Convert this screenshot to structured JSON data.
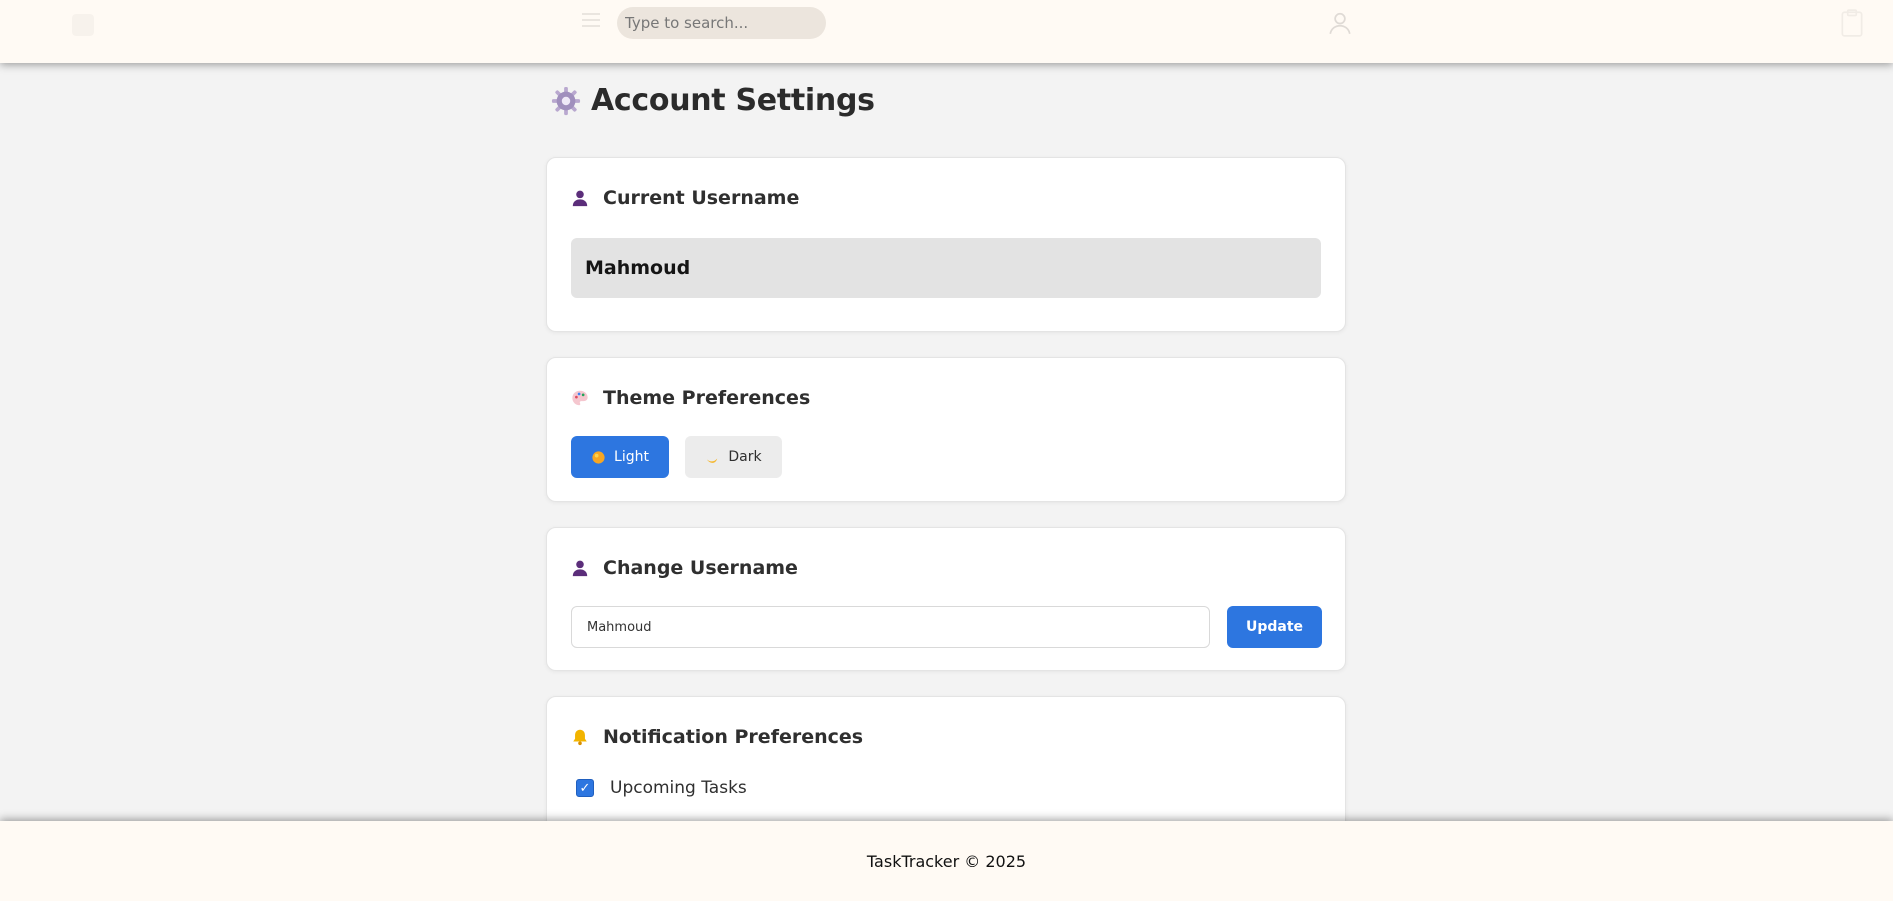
{
  "header": {
    "search_placeholder": "Type to search...",
    "menu_icon": "hamburger-icon",
    "user_icon": "user-icon",
    "clipboard_icon": "clipboard-icon"
  },
  "page": {
    "title": "Account Settings",
    "title_icon": "gear-icon"
  },
  "current_username": {
    "heading": "Current Username",
    "icon": "person-icon",
    "value": "Mahmoud"
  },
  "theme": {
    "heading": "Theme Preferences",
    "icon": "palette-icon",
    "light_label": "Light",
    "light_icon": "sun-icon",
    "dark_label": "Dark",
    "dark_icon": "moon-icon",
    "selected": "Light"
  },
  "change_username": {
    "heading": "Change Username",
    "icon": "person-icon",
    "input_value": "Mahmoud",
    "button_label": "Update"
  },
  "notifications": {
    "heading": "Notification Preferences",
    "icon": "bell-icon",
    "items": [
      {
        "label": "Upcoming Tasks",
        "checked": true,
        "check_glyph": "✓"
      }
    ]
  },
  "footer": {
    "text": "TaskTracker © 2025"
  },
  "colors": {
    "accent": "#2d76e0",
    "header_bg": "#fffaf4",
    "page_bg": "#f3f3f3",
    "person_icon": "#5b2d7a",
    "bell_icon": "#f2b400"
  }
}
